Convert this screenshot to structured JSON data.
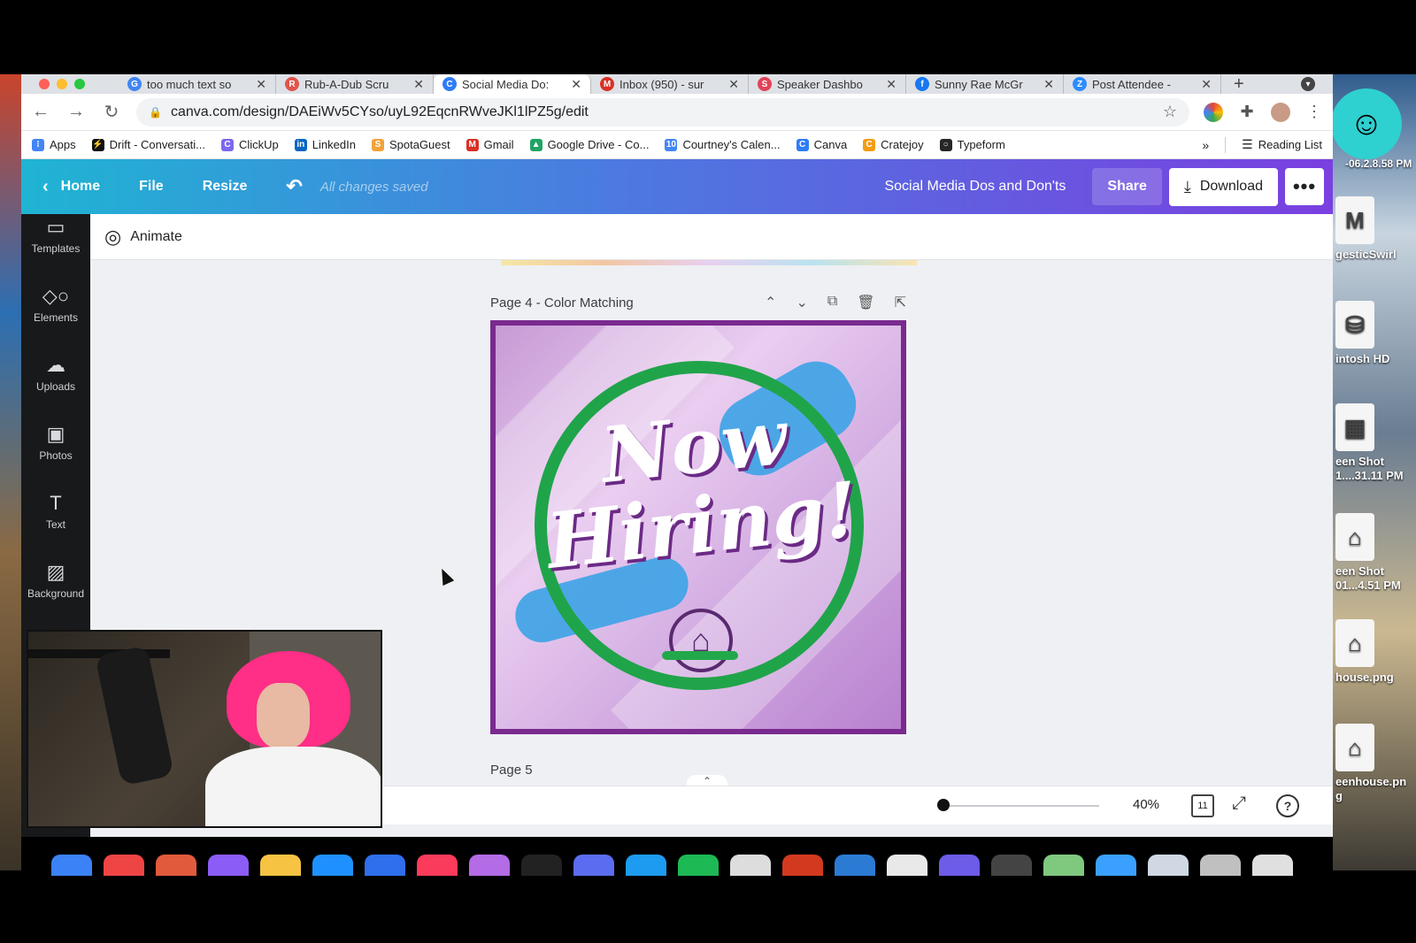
{
  "browser": {
    "tabs": [
      {
        "label": "too much text so",
        "icon": "google-icon",
        "color": "#4285f4",
        "glyph": "G"
      },
      {
        "label": "Rub-A-Dub Scru",
        "icon": "doc-icon",
        "color": "#e0544a",
        "glyph": "R"
      },
      {
        "label": "Social Media Do:",
        "icon": "canva-icon",
        "color": "#2e7cf6",
        "glyph": "C",
        "active": true
      },
      {
        "label": "Inbox (950) - sur",
        "icon": "gmail-icon",
        "color": "#d93025",
        "glyph": "M"
      },
      {
        "label": "Speaker Dashbo",
        "icon": "speaker-icon",
        "color": "#e2425a",
        "glyph": "S"
      },
      {
        "label": "Sunny Rae McGr",
        "icon": "facebook-icon",
        "color": "#1877f2",
        "glyph": "f"
      },
      {
        "label": "Post Attendee -",
        "icon": "zoom-icon",
        "color": "#2d8cff",
        "glyph": "Z"
      }
    ],
    "url": "canva.com/design/DAEiWv5CYso/uyL92EqcnRWveJKl1lPZ5g/edit",
    "bookmarks": [
      {
        "label": "Apps",
        "color": "#4285f4",
        "glyph": "⁝"
      },
      {
        "label": "Drift - Conversati...",
        "color": "#111111",
        "glyph": "⚡"
      },
      {
        "label": "ClickUp",
        "color": "#7b68ee",
        "glyph": "C"
      },
      {
        "label": "LinkedIn",
        "color": "#0a66c2",
        "glyph": "in"
      },
      {
        "label": "SpotaGuest",
        "color": "#f2a33a",
        "glyph": "S"
      },
      {
        "label": "Gmail",
        "color": "#d93025",
        "glyph": "M"
      },
      {
        "label": "Google Drive - Co...",
        "color": "#1fa463",
        "glyph": "▲"
      },
      {
        "label": "Courtney's Calen...",
        "color": "#4285f4",
        "glyph": "10"
      },
      {
        "label": "Canva",
        "color": "#2e7cf6",
        "glyph": "C"
      },
      {
        "label": "Cratejoy",
        "color": "#f39c12",
        "glyph": "C"
      },
      {
        "label": "Typeform",
        "color": "#262627",
        "glyph": "○"
      }
    ],
    "bookmarks_more": "»",
    "reading_list": "Reading List"
  },
  "canva": {
    "home": "Home",
    "file": "File",
    "resize": "Resize",
    "saved_status": "All changes saved",
    "doc_title": "Social Media Dos and Don'ts",
    "share": "Share",
    "download": "Download",
    "more": "•••",
    "sidebar": [
      {
        "label": "Templates",
        "icon": "templates-icon",
        "glyph": "▭"
      },
      {
        "label": "Elements",
        "icon": "elements-icon",
        "glyph": "◇○"
      },
      {
        "label": "Uploads",
        "icon": "uploads-icon",
        "glyph": "☁"
      },
      {
        "label": "Photos",
        "icon": "photos-icon",
        "glyph": "▣"
      },
      {
        "label": "Text",
        "icon": "text-icon",
        "glyph": "T"
      },
      {
        "label": "Background",
        "icon": "background-icon",
        "glyph": "▨"
      }
    ],
    "animate": "Animate",
    "page4_title": "Page 4 - Color Matching",
    "design_text_line1": "Now",
    "design_text_line2": "Hiring!",
    "page5_title": "Page 5",
    "zoom": "40%",
    "page_count": "11",
    "help": "?"
  },
  "desktop": {
    "items": [
      {
        "label": "gesticSwirl",
        "icon": "m-logo-icon",
        "glyph": "M"
      },
      {
        "label": "intosh HD",
        "icon": "disk-icon",
        "glyph": "⛁"
      },
      {
        "label": "een Shot\n1....31.11 PM",
        "icon": "screenshot-icon",
        "glyph": "▦"
      },
      {
        "label": "een Shot\n01...4.51 PM",
        "icon": "screenshot-icon",
        "glyph": "⌂"
      },
      {
        "label": "house.png",
        "icon": "image-file-icon",
        "glyph": "⌂"
      },
      {
        "label": "eenhouse.pn\ng",
        "icon": "image-file-icon",
        "glyph": "⌂"
      }
    ],
    "clock_text": "-06.2.8.58 PM"
  },
  "colors": {
    "header_start": "#1fb4d3",
    "header_end": "#7a3fe0",
    "design_border": "#7a2a8f",
    "ring": "#20a44a"
  }
}
